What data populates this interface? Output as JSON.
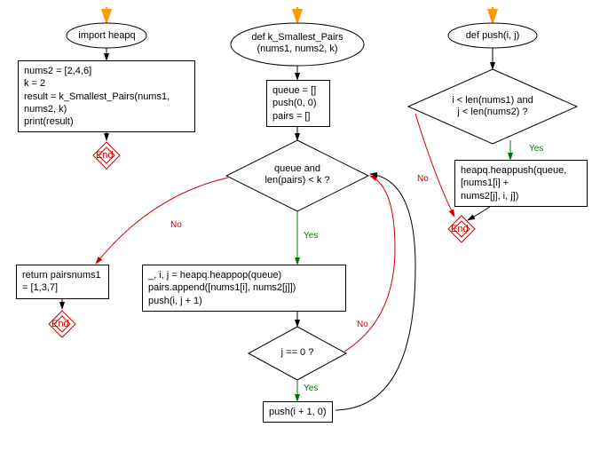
{
  "col1": {
    "start": "import heapq",
    "block1": "nums2 = [2,4,6]\nk = 2\nresult = k_Smallest_Pairs(nums1,\nnums2, k)\nprint(result)",
    "end": "End"
  },
  "col2": {
    "funcdef": "def k_Smallest_Pairs\n(nums1, nums2, k)",
    "init": "queue = []\npush(0, 0)\npairs = []",
    "cond1": "queue and\nlen(pairs) < k ?",
    "noexit": "return pairsnums1\n= [1,3,7]",
    "noexit_end": "End",
    "pop": "_, i, j = heapq.heappop(queue)\npairs.append([nums1[i], nums2[j]])\npush(i, j + 1)",
    "cond2": "j == 0 ?",
    "push_next": "push(i + 1, 0)"
  },
  "col3": {
    "funcdef": "def push(i, j)",
    "cond": "i < len(nums1) and\nj < len(nums2) ?",
    "heappush": "heapq.heappush(queue,\n[nums1[i] +\nnums2[j], i, j])",
    "end": "End"
  },
  "labels": {
    "yes": "Yes",
    "no": "No"
  }
}
